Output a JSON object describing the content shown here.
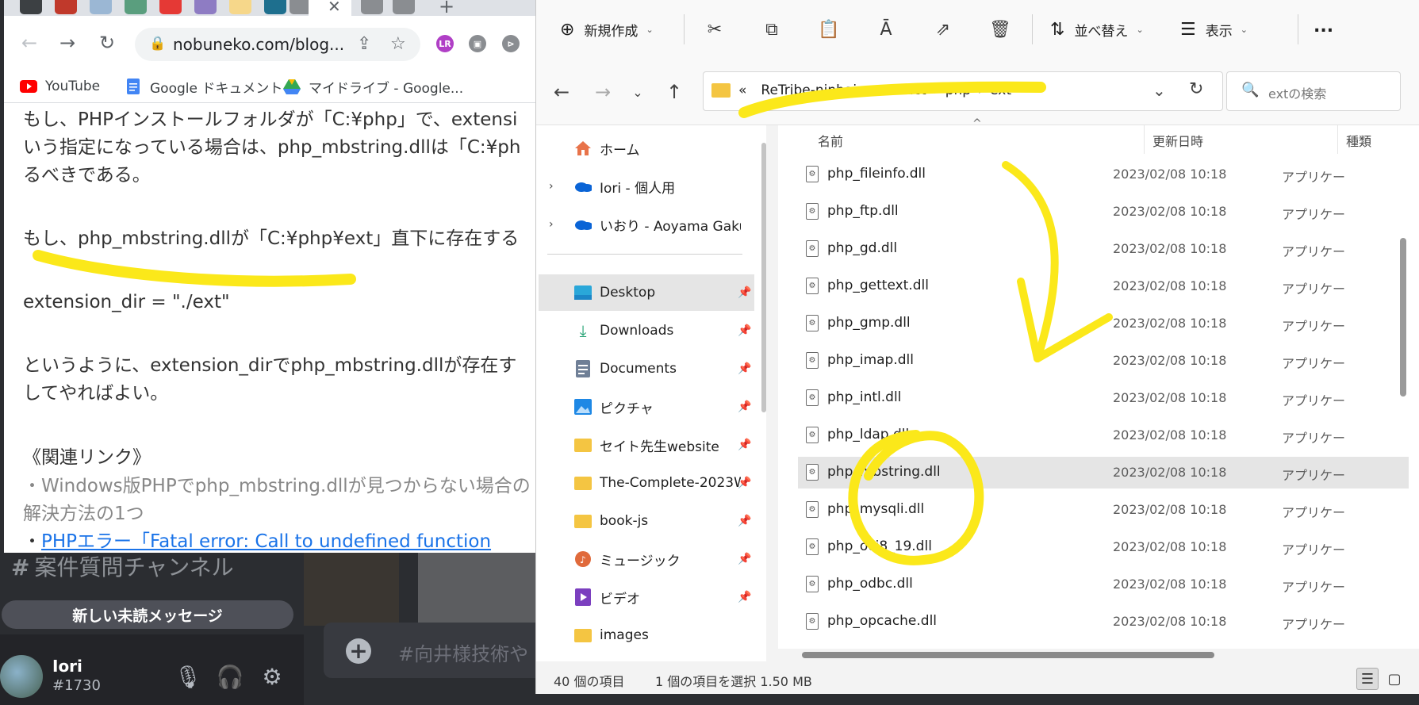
{
  "chrome": {
    "url": "nobuneko.com/blog...",
    "bookmarks": [
      {
        "label": "YouTube",
        "icon": "youtube-icon"
      },
      {
        "label": "Google ドキュメント",
        "icon": "docs-icon"
      },
      {
        "label": "マイドライブ - Google...",
        "icon": "drive-icon"
      }
    ],
    "article": {
      "p1_line1": "もし、PHPインストールフォルダが「C:¥php」で、extensi",
      "p1_line2": "いう指定になっている場合は、php_mbstring.dllは「C:¥ph",
      "p1_line3": "るべきである。",
      "p2": "もし、php_mbstring.dllが「C:¥php¥ext」直下に存在する",
      "code": "extension_dir = \"./ext\"",
      "p3_line1": "というように、extension_dirでphp_mbstring.dllが存在す",
      "p3_line2": "してやればよい。",
      "related_heading": "《関連リンク》",
      "link1_line1": "・Windows版PHPでphp_mbstring.dllが見つからない場合の",
      "link1_line2": "解決方法の1つ",
      "link2_bullet": "・",
      "link2_text": "PHPエラー「Fatal error: Call to undefined function"
    }
  },
  "discord": {
    "channel": "案件質問チャンネル",
    "unread": "新しい未読メッセージ",
    "username": "Iori",
    "tag": "#1730",
    "message_placeholder": "#向井様技術や"
  },
  "explorer": {
    "commands": {
      "new": "新規作成",
      "sort": "並べ替え",
      "view": "表示",
      "more": "..."
    },
    "breadcrumb": {
      "overflow": "«",
      "items": [
        "ReTribe-ninbai",
        "contact",
        "php",
        "ext"
      ]
    },
    "search_placeholder": "extの検索",
    "nav": [
      {
        "label": "ホーム",
        "icon": "home-icon"
      },
      {
        "label": "Iori - 個人用",
        "icon": "onedrive-icon"
      },
      {
        "label": "いおり - Aoyama Gakuin",
        "icon": "onedrive-icon"
      },
      {
        "label": "Desktop",
        "icon": "desktop-icon"
      },
      {
        "label": "Downloads",
        "icon": "downloads-icon"
      },
      {
        "label": "Documents",
        "icon": "documents-icon"
      },
      {
        "label": "ピクチャ",
        "icon": "pictures-icon"
      },
      {
        "label": "セイト先生website",
        "icon": "folder-icon"
      },
      {
        "label": "The-Complete-2023W",
        "icon": "folder-icon"
      },
      {
        "label": "book-js",
        "icon": "folder-icon"
      },
      {
        "label": "ミュージック",
        "icon": "music-icon"
      },
      {
        "label": "ビデオ",
        "icon": "videos-icon"
      },
      {
        "label": "images",
        "icon": "folder-icon"
      }
    ],
    "columns": {
      "name": "名前",
      "modified": "更新日時",
      "type": "種類"
    },
    "files": [
      {
        "name": "php_fileinfo.dll",
        "date": "2023/02/08 10:18",
        "type": "アプリケー"
      },
      {
        "name": "php_ftp.dll",
        "date": "2023/02/08 10:18",
        "type": "アプリケー"
      },
      {
        "name": "php_gd.dll",
        "date": "2023/02/08 10:18",
        "type": "アプリケー"
      },
      {
        "name": "php_gettext.dll",
        "date": "2023/02/08 10:18",
        "type": "アプリケー"
      },
      {
        "name": "php_gmp.dll",
        "date": "2023/02/08 10:18",
        "type": "アプリケー"
      },
      {
        "name": "php_imap.dll",
        "date": "2023/02/08 10:18",
        "type": "アプリケー"
      },
      {
        "name": "php_intl.dll",
        "date": "2023/02/08 10:18",
        "type": "アプリケー"
      },
      {
        "name": "php_ldap.dll",
        "date": "2023/02/08 10:18",
        "type": "アプリケー"
      },
      {
        "name": "php_mbstring.dll",
        "date": "2023/02/08 10:18",
        "type": "アプリケー",
        "selected": true
      },
      {
        "name": "php_mysqli.dll",
        "date": "2023/02/08 10:18",
        "type": "アプリケー"
      },
      {
        "name": "php_oci8_19.dll",
        "date": "2023/02/08 10:18",
        "type": "アプリケー"
      },
      {
        "name": "php_odbc.dll",
        "date": "2023/02/08 10:18",
        "type": "アプリケー"
      },
      {
        "name": "php_opcache.dll",
        "date": "2023/02/08 10:18",
        "type": "アプリケー"
      }
    ],
    "status": {
      "count": "40 個の項目",
      "selection": "1 個の項目を選択 1.50 MB"
    }
  },
  "colors": {
    "annotation": "#fbe81a",
    "selection": "#e5e5e5",
    "link": "#1a73e8",
    "discord_bg": "#2b2d31"
  }
}
